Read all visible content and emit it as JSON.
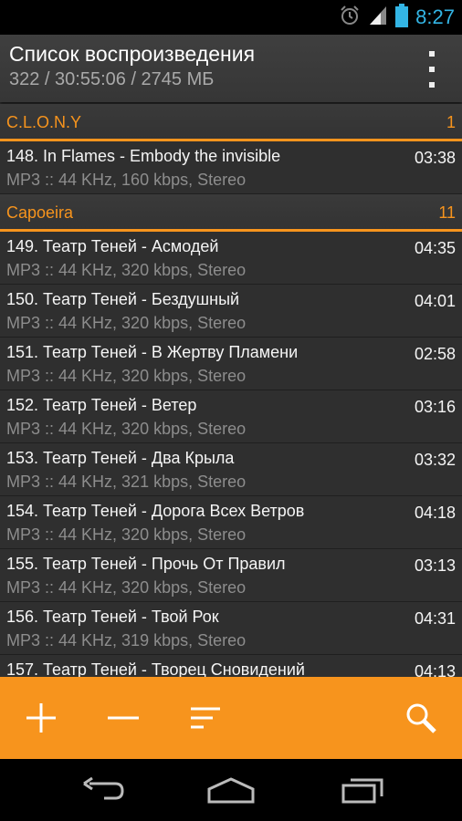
{
  "status_bar": {
    "time": "8:27",
    "icons": [
      "alarm-icon",
      "signal-icon",
      "battery-icon"
    ]
  },
  "action_bar": {
    "title": "Список воспроизведения",
    "subtitle": "322 / 30:55:06 / 2745 МБ",
    "overflow_icon": "overflow-menu-icon"
  },
  "groups": [
    {
      "name": "C.L.O.N.Y",
      "count": "1",
      "tracks": [
        {
          "title": "148. In Flames - Embody the invisible",
          "duration": "03:38",
          "meta": "MP3 :: 44 KHz, 160 kbps, Stereo"
        }
      ]
    },
    {
      "name": "Capoeira",
      "count": "11",
      "tracks": [
        {
          "title": "149. Театр Теней - Асмодей",
          "duration": "04:35",
          "meta": "MP3 :: 44 KHz, 320 kbps, Stereo"
        },
        {
          "title": "150. Театр Теней - Бездушный",
          "duration": "04:01",
          "meta": "MP3 :: 44 KHz, 320 kbps, Stereo"
        },
        {
          "title": "151. Театр Теней - В Жертву Пламени",
          "duration": "02:58",
          "meta": "MP3 :: 44 KHz, 320 kbps, Stereo"
        },
        {
          "title": "152. Театр Теней - Ветер",
          "duration": "03:16",
          "meta": "MP3 :: 44 KHz, 320 kbps, Stereo"
        },
        {
          "title": "153. Театр Теней - Два Крыла",
          "duration": "03:32",
          "meta": "MP3 :: 44 KHz, 321 kbps, Stereo"
        },
        {
          "title": "154. Театр Теней - Дорога Всех Ветров",
          "duration": "04:18",
          "meta": "MP3 :: 44 KHz, 320 kbps, Stereo"
        },
        {
          "title": "155. Театр Теней - Прочь От Правил",
          "duration": "03:13",
          "meta": "MP3 :: 44 KHz, 320 kbps, Stereo"
        },
        {
          "title": "156. Театр Теней - Твой Рок",
          "duration": "04:31",
          "meta": "MP3 :: 44 KHz, 319 kbps, Stereo"
        },
        {
          "title": "157. Театр Теней - Творец Сновидений",
          "duration": "04:13",
          "meta": ""
        }
      ]
    }
  ],
  "toolbar": {
    "buttons": [
      "add-icon",
      "remove-icon",
      "sort-icon",
      "search-icon"
    ]
  },
  "nav_bar": {
    "buttons": [
      "back-icon",
      "home-icon",
      "recents-icon"
    ]
  },
  "colors": {
    "accent": "#f7941d",
    "status_time": "#33b5e5",
    "background": "#2f2f2f"
  }
}
